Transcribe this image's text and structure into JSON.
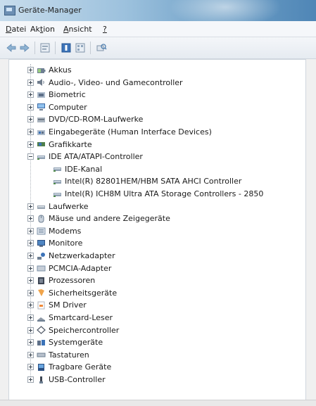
{
  "window": {
    "title": "Geräte-Manager"
  },
  "menu": [
    "Datei",
    "Aktion",
    "Ansicht",
    "?"
  ],
  "toolbar": [
    "back-icon",
    "forward-icon",
    "properties-icon",
    "help-icon",
    "view-icon",
    "scan-icon"
  ],
  "tree": [
    {
      "label": "Akkus",
      "icon": "battery-icon",
      "level": 0,
      "expanded": false
    },
    {
      "label": "Audio-, Video- und Gamecontroller",
      "icon": "audio-icon",
      "level": 0,
      "expanded": false
    },
    {
      "label": "Biometric",
      "icon": "biometric-icon",
      "level": 0,
      "expanded": false
    },
    {
      "label": "Computer",
      "icon": "computer-icon",
      "level": 0,
      "expanded": false
    },
    {
      "label": "DVD/CD-ROM-Laufwerke",
      "icon": "dvd-icon",
      "level": 0,
      "expanded": false
    },
    {
      "label": "Eingabegeräte (Human Interface Devices)",
      "icon": "hid-icon",
      "level": 0,
      "expanded": false
    },
    {
      "label": "Grafikkarte",
      "icon": "display-adapter-icon",
      "level": 0,
      "expanded": false
    },
    {
      "label": "IDE ATA/ATAPI-Controller",
      "icon": "ide-controller-icon",
      "level": 0,
      "expanded": true
    },
    {
      "label": "IDE-Kanal",
      "icon": "ide-controller-icon",
      "level": 1
    },
    {
      "label": "Intel(R) 82801HEM/HBM SATA AHCI Controller",
      "icon": "ide-controller-icon",
      "level": 1
    },
    {
      "label": "Intel(R) ICH8M Ultra ATA Storage Controllers - 2850",
      "icon": "ide-controller-icon",
      "level": 1
    },
    {
      "label": "Laufwerke",
      "icon": "disk-drive-icon",
      "level": 0,
      "expanded": false
    },
    {
      "label": "Mäuse und andere Zeigegeräte",
      "icon": "mouse-icon",
      "level": 0,
      "expanded": false
    },
    {
      "label": "Modems",
      "icon": "modem-icon",
      "level": 0,
      "expanded": false
    },
    {
      "label": "Monitore",
      "icon": "monitor-icon",
      "level": 0,
      "expanded": false
    },
    {
      "label": "Netzwerkadapter",
      "icon": "network-icon",
      "level": 0,
      "expanded": false
    },
    {
      "label": "PCMCIA-Adapter",
      "icon": "pcmcia-icon",
      "level": 0,
      "expanded": false
    },
    {
      "label": "Prozessoren",
      "icon": "processor-icon",
      "level": 0,
      "expanded": false
    },
    {
      "label": "Sicherheitsgeräte",
      "icon": "security-icon",
      "level": 0,
      "expanded": false
    },
    {
      "label": "SM Driver",
      "icon": "driver-icon",
      "level": 0,
      "expanded": false
    },
    {
      "label": "Smartcard-Leser",
      "icon": "smartcard-icon",
      "level": 0,
      "expanded": false
    },
    {
      "label": "Speichercontroller",
      "icon": "storage-controller-icon",
      "level": 0,
      "expanded": false
    },
    {
      "label": "Systemgeräte",
      "icon": "system-devices-icon",
      "level": 0,
      "expanded": false
    },
    {
      "label": "Tastaturen",
      "icon": "keyboard-icon",
      "level": 0,
      "expanded": false
    },
    {
      "label": "Tragbare Geräte",
      "icon": "portable-device-icon",
      "level": 0,
      "expanded": false
    },
    {
      "label": "USB-Controller",
      "icon": "usb-icon",
      "level": 0,
      "expanded": false
    }
  ]
}
